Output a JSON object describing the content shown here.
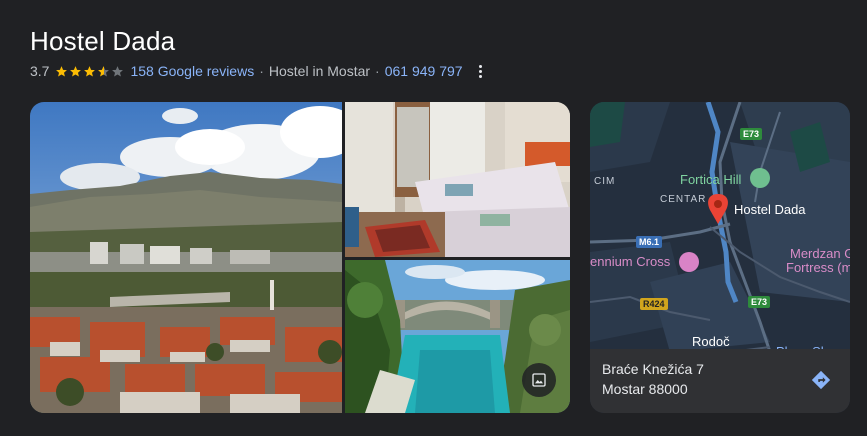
{
  "place": {
    "name": "Hostel Dada",
    "rating": "3.7",
    "reviews_label": "158 Google reviews",
    "category": "Hostel in Mostar",
    "phone": "061 949 797"
  },
  "rating_stars": {
    "value": 3.7,
    "max": 5
  },
  "colors": {
    "link": "#8ab4f8",
    "star": "#fbbc04",
    "pin": "#ea4335",
    "background": "#202124"
  },
  "map": {
    "labels": {
      "cim": "CIM",
      "centar": "CENTAR",
      "fortica": "Fortica Hill",
      "hostel": "Hostel Dada",
      "merdzan1": "Merdzan G",
      "merdzan2": "Fortress (m",
      "cross": "ennium Cross",
      "rodoc": "Rodoč",
      "plaza": "Plaza Shopp"
    },
    "shields": {
      "e73_top": "E73",
      "m61": "M6.1",
      "r424": "R424",
      "e73_bottom": "E73"
    },
    "address_line1": "Braće Knežića 7",
    "address_line2": "Mostar 88000"
  },
  "icons": {
    "more": "more-vert-icon",
    "photos": "photo-library-icon",
    "directions": "directions-icon",
    "pin": "map-pin-icon"
  }
}
